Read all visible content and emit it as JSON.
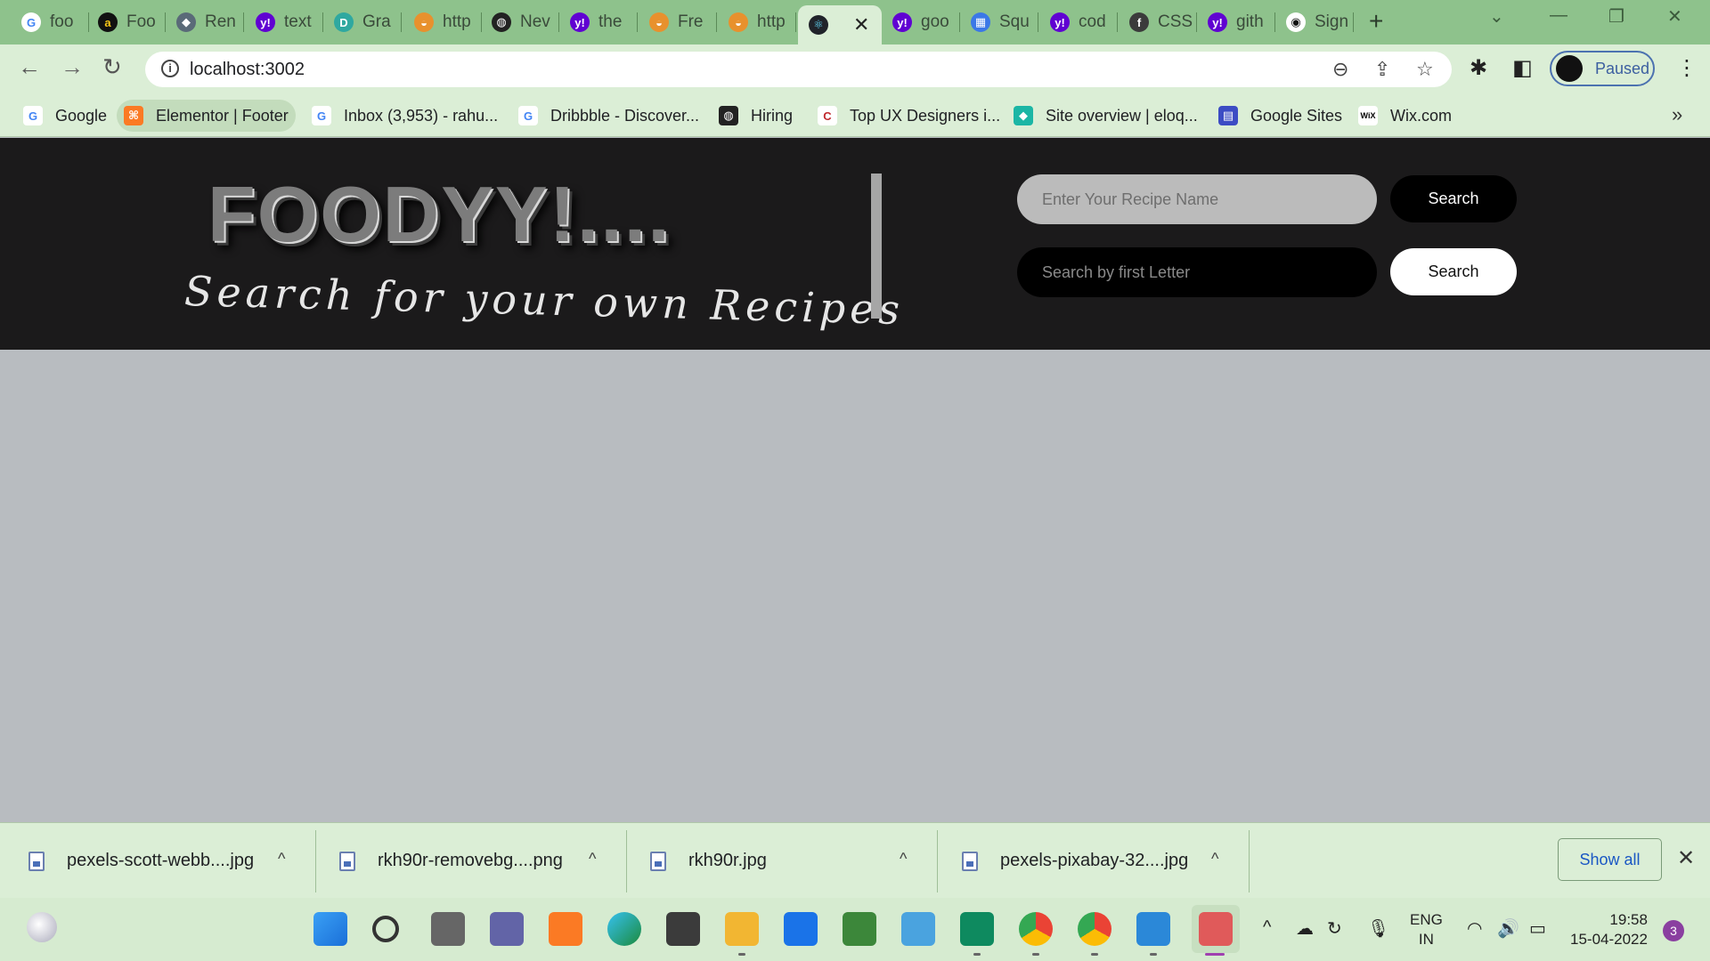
{
  "browser": {
    "tabs": [
      {
        "title": "foo",
        "icon": "google-icon",
        "color": "#ffffff",
        "glyph": "G",
        "fg": "#4285f4"
      },
      {
        "title": "Foo",
        "icon": "letter-a-icon",
        "color": "#111111",
        "glyph": "a",
        "fg": "#f5c518"
      },
      {
        "title": "Ren",
        "icon": "layers-icon",
        "color": "#5a6a78",
        "glyph": "◆",
        "fg": "#ffffff"
      },
      {
        "title": "text",
        "icon": "yahoo-icon",
        "color": "#6001d2",
        "glyph": "y!",
        "fg": "#ffffff"
      },
      {
        "title": "Gra",
        "icon": "grammar-icon",
        "color": "#2fa8a0",
        "glyph": "D",
        "fg": "#ffffff"
      },
      {
        "title": "http",
        "icon": "food-bowl-icon",
        "color": "#e8912d",
        "glyph": "◒",
        "fg": "#ffffff"
      },
      {
        "title": "Nev",
        "icon": "globe-icon",
        "color": "#222222",
        "glyph": "◍",
        "fg": "#ffffff"
      },
      {
        "title": "the",
        "icon": "yahoo-icon",
        "color": "#6001d2",
        "glyph": "y!",
        "fg": "#ffffff"
      },
      {
        "title": "Fre",
        "icon": "food-bowl-icon",
        "color": "#e8912d",
        "glyph": "◒",
        "fg": "#ffffff"
      },
      {
        "title": "http",
        "icon": "food-bowl-icon",
        "color": "#e8912d",
        "glyph": "◒",
        "fg": "#ffffff"
      },
      {
        "title": "",
        "icon": "react-icon",
        "color": "#20232a",
        "glyph": "⚛",
        "fg": "#61dafb",
        "active": true
      },
      {
        "title": "goo",
        "icon": "yahoo-icon",
        "color": "#6001d2",
        "glyph": "y!",
        "fg": "#ffffff"
      },
      {
        "title": "Squ",
        "icon": "squares-icon",
        "color": "#3b78e7",
        "glyph": "▦",
        "fg": "#ffffff"
      },
      {
        "title": "cod",
        "icon": "yahoo-icon",
        "color": "#6001d2",
        "glyph": "y!",
        "fg": "#ffffff"
      },
      {
        "title": "CSS",
        "icon": "facebook-icon",
        "color": "#3b3b3b",
        "glyph": "f",
        "fg": "#ffffff"
      },
      {
        "title": "gith",
        "icon": "yahoo-icon",
        "color": "#6001d2",
        "glyph": "y!",
        "fg": "#ffffff"
      },
      {
        "title": "Sign",
        "icon": "github-icon",
        "color": "#ffffff",
        "glyph": "◉",
        "fg": "#111111"
      }
    ],
    "url": "localhost:3002",
    "profile_label": "Paused",
    "bookmarks": [
      {
        "label": "Google",
        "icon": "google-icon",
        "color": "#ffffff",
        "glyph": "G",
        "fg": "#4285f4"
      },
      {
        "label": "Elementor | Footer",
        "icon": "xampp-icon",
        "color": "#fb7a24",
        "glyph": "⌘",
        "fg": "#ffffff",
        "highlight": true
      },
      {
        "label": "Inbox (3,953) - rahu...",
        "icon": "google-icon",
        "color": "#ffffff",
        "glyph": "G",
        "fg": "#4285f4"
      },
      {
        "label": "Dribbble - Discover...",
        "icon": "google-icon",
        "color": "#ffffff",
        "glyph": "G",
        "fg": "#4285f4"
      },
      {
        "label": "Hiring",
        "icon": "globe-icon",
        "color": "#222222",
        "glyph": "◍",
        "fg": "#ffffff"
      },
      {
        "label": "Top UX Designers i...",
        "icon": "c-logo-icon",
        "color": "#ffffff",
        "glyph": "C",
        "fg": "#c0282d"
      },
      {
        "label": "Site overview | eloq...",
        "icon": "diamond-icon",
        "color": "#1bb6a5",
        "glyph": "◆",
        "fg": "#ffffff"
      },
      {
        "label": "Google Sites",
        "icon": "google-sites-icon",
        "color": "#3c4cc4",
        "glyph": "▤",
        "fg": "#ffffff"
      },
      {
        "label": "Wix.com",
        "icon": "wix-icon",
        "color": "#ffffff",
        "glyph": "WiX",
        "fg": "#000000"
      }
    ]
  },
  "page": {
    "logo": "FOODYY!....",
    "tagline": "Search for your own Recipes",
    "recipe_search_placeholder": "Enter Your Recipe Name",
    "recipe_search_button": "Search",
    "letter_search_placeholder": "Search by first Letter",
    "letter_search_button": "Search"
  },
  "downloads": {
    "items": [
      {
        "name": "pexels-scott-webb....jpg"
      },
      {
        "name": "rkh90r-removebg....png"
      },
      {
        "name": "rkh90r.jpg"
      },
      {
        "name": "pexels-pixabay-32....jpg"
      }
    ],
    "show_all": "Show all"
  },
  "taskbar": {
    "lang_line1": "ENG",
    "lang_line2": "IN",
    "time": "19:58",
    "date": "15-04-2022",
    "notifications": "3"
  }
}
